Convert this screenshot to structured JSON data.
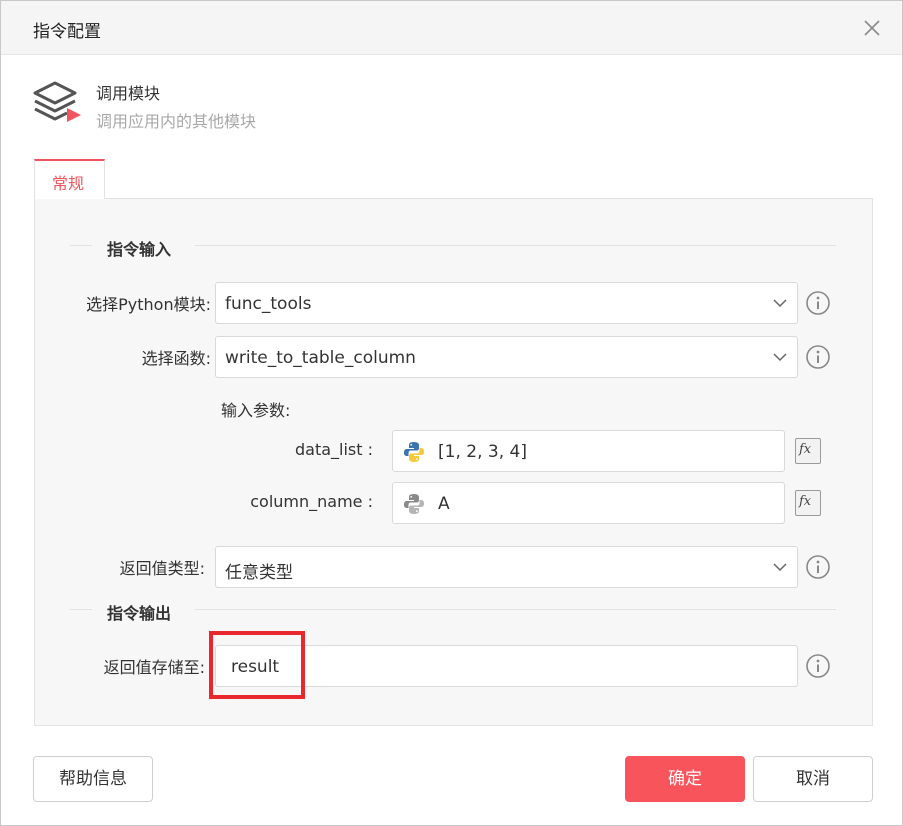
{
  "dialog": {
    "title": "指令配置",
    "close_icon": "close-icon"
  },
  "module": {
    "icon": "layers-play-icon",
    "name": "调用模块",
    "description": "调用应用内的其他模块"
  },
  "tabs": [
    {
      "label": "常规",
      "active": true
    }
  ],
  "input_section": {
    "title": "指令输入",
    "python_module": {
      "label": "选择Python模块:",
      "value": "func_tools"
    },
    "function": {
      "label": "选择函数:",
      "value": "write_to_table_column"
    },
    "params_label": "输入参数:",
    "params": [
      {
        "label": "data_list :",
        "value": "[1, 2, 3, 4]",
        "icon": "python-icon",
        "fx": "fx"
      },
      {
        "label": "column_name :",
        "value": "A",
        "icon": "python-icon-gray",
        "fx": "fx"
      }
    ],
    "return_type": {
      "label": "返回值类型:",
      "value": "任意类型"
    }
  },
  "output_section": {
    "title": "指令输出",
    "store_to": {
      "label": "返回值存储至:",
      "value": "result"
    }
  },
  "buttons": {
    "help": "帮助信息",
    "confirm": "确定",
    "cancel": "取消"
  },
  "colors": {
    "accent": "#f7545c",
    "highlight": "#e9282e"
  }
}
